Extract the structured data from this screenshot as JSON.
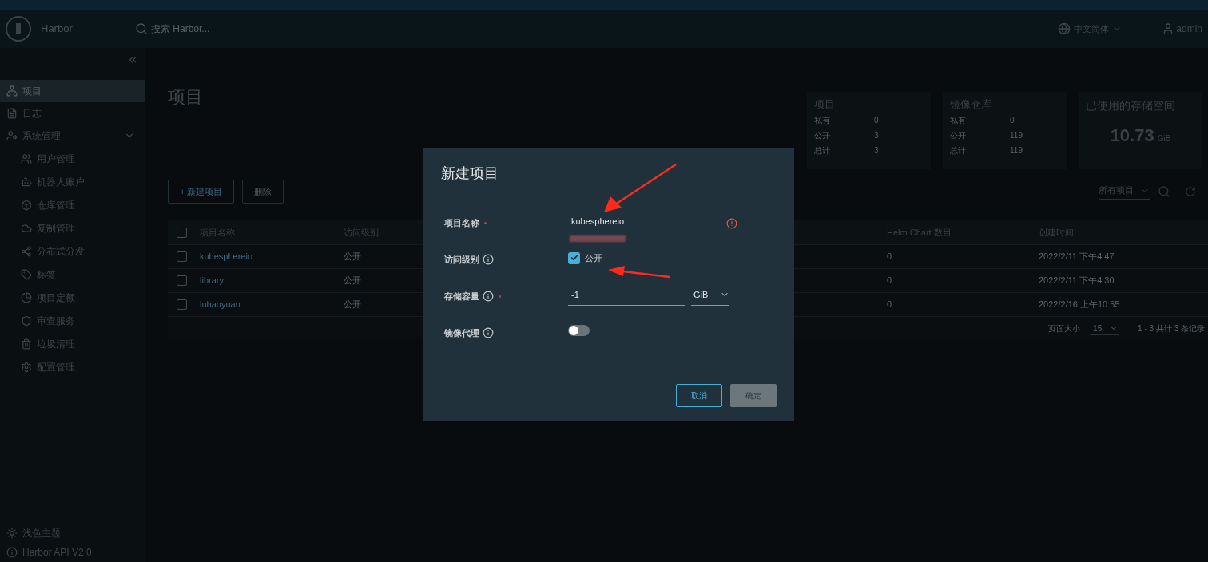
{
  "header": {
    "product": "Harbor",
    "search": {
      "placeholder": "搜索 Harbor..."
    },
    "language": "中文简体",
    "user": "admin"
  },
  "sidebar": {
    "items": [
      {
        "label": "项目",
        "selected": true
      },
      {
        "label": "日志",
        "selected": false
      },
      {
        "label": "系统管理",
        "selected": false,
        "expanded": true,
        "children": [
          {
            "label": "用户管理",
            "selected": false
          },
          {
            "label": "机器人账户",
            "selected": false
          },
          {
            "label": "仓库管理",
            "selected": false
          },
          {
            "label": "复制管理",
            "selected": false
          },
          {
            "label": "分布式分发",
            "selected": false
          },
          {
            "label": "标签",
            "selected": false
          },
          {
            "label": "项目定额",
            "selected": false
          },
          {
            "label": "审查服务",
            "selected": false
          },
          {
            "label": "垃圾清理",
            "selected": false
          },
          {
            "label": "配置管理",
            "selected": false
          }
        ]
      }
    ],
    "footer": [
      {
        "label": "浅色主题"
      },
      {
        "label": "Harbor API V2.0"
      }
    ]
  },
  "page_title": "项目",
  "stats": [
    {
      "title": "项目",
      "rows": [
        {
          "label": "私有",
          "value": "0"
        },
        {
          "label": "公开",
          "value": "3"
        },
        {
          "label": "总计",
          "value": "3"
        }
      ]
    },
    {
      "title": "镜像仓库",
      "rows": [
        {
          "label": "私有",
          "value": "0"
        },
        {
          "label": "公开",
          "value": "119"
        },
        {
          "label": "总计",
          "value": "119"
        }
      ]
    },
    {
      "title": "已使用的存储空间",
      "amount": "10.73",
      "unit": "GiB"
    }
  ],
  "toolbar": {
    "buttons": [
      {
        "label": "+ 新建项目",
        "disabled": false
      },
      {
        "label": "删除",
        "disabled": true
      }
    ],
    "filter": "所有项目"
  },
  "table": {
    "columns": [
      "项目名称",
      "访问级别",
      "Helm Chart 数目",
      "创建时间"
    ],
    "select_all_checked": false,
    "rows": [
      {
        "checked": false,
        "name": "kubesphereio",
        "access": "公开",
        "helm": "0",
        "created": "2022/2/11 下午4:47"
      },
      {
        "checked": false,
        "name": "library",
        "access": "公开",
        "helm": "0",
        "created": "2022/2/11 下午4:30"
      },
      {
        "checked": false,
        "name": "luhaoyuan",
        "access": "公开",
        "helm": "0",
        "created": "2022/2/16 上午10:55"
      }
    ],
    "page_size_label": "页面大小",
    "page_size": "15",
    "summary": "1 - 3 共计 3 条记录"
  },
  "dialog": {
    "title": "新建项目",
    "fields": [
      {
        "kind": "text",
        "label": "项目名称",
        "required": true,
        "info": false,
        "value": "kubesphereio",
        "error": true
      },
      {
        "kind": "checkbox",
        "label": "访问级别",
        "required": false,
        "info": true,
        "checked": true,
        "option": "公开"
      },
      {
        "kind": "number",
        "label": "存储容量",
        "required": true,
        "info": true,
        "value": "-1",
        "unit": "GiB"
      },
      {
        "kind": "toggle",
        "label": "镜像代理",
        "required": false,
        "info": true,
        "on": false
      }
    ],
    "buttons": [
      {
        "label": "取消",
        "primary": false,
        "disabled": false
      },
      {
        "label": "确定",
        "primary": true,
        "disabled": true
      }
    ]
  }
}
